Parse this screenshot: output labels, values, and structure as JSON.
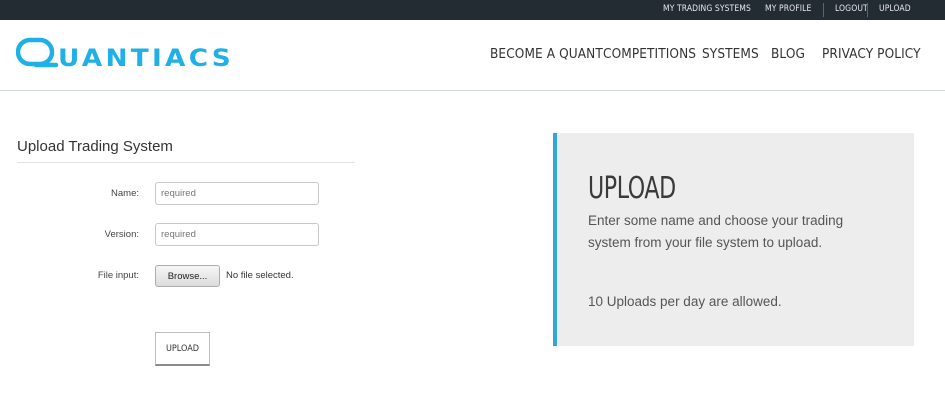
{
  "topbar": {
    "my_trading_systems": "MY TRADING SYSTEMS",
    "my_profile": "MY PROFILE",
    "logout": "LOGOUT",
    "upload": "UPLOAD"
  },
  "header": {
    "logo_text": "QUANTIACS",
    "logo_color": "#1fb0e8",
    "nav": {
      "become_a_quant": "BECOME A QUANT",
      "competitions": "COMPETITIONS",
      "systems": "SYSTEMS",
      "blog": "BLOG",
      "privacy_policy": "PRIVACY POLICY"
    }
  },
  "form": {
    "title": "Upload Trading System",
    "name_label": "Name:",
    "name_placeholder": "required",
    "version_label": "Version:",
    "version_placeholder": "required",
    "file_label": "File input:",
    "browse_label": "Browse...",
    "file_status": "No file selected.",
    "submit_label": "UPLOAD"
  },
  "panel": {
    "title": "UPLOAD",
    "description": "Enter some name and choose your trading system from your file system to upload.",
    "limit_note": "10 Uploads per day are allowed.",
    "accent_color": "#2fa6dc"
  }
}
